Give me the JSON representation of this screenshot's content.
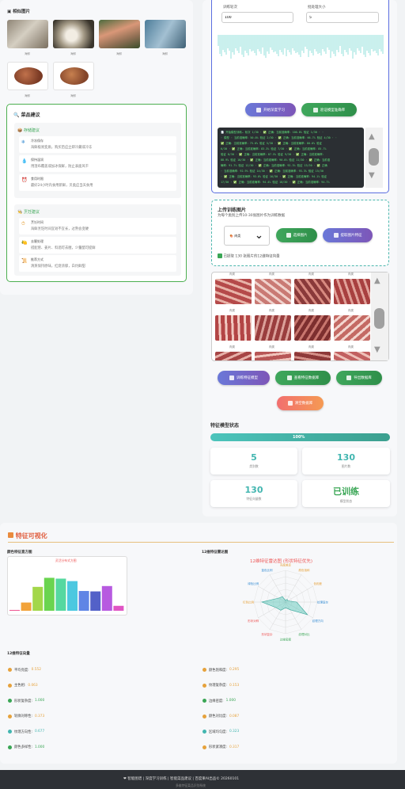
{
  "similar_images": {
    "title": "相似图片",
    "captions": [
      "海鲜",
      "海鲜",
      "海鲜",
      "海鲜",
      "海鲜",
      "海鲜"
    ]
  },
  "advice": {
    "title": "菜品建议",
    "storage": {
      "title": "存储建议",
      "items": [
        {
          "title": "冷冻保存",
          "text": "海鲜极易变质，购买后应立即冷藏或冷冻"
        },
        {
          "title": "保持湿润",
          "text": "用湿布覆盖或加冰保鲜，防止表面风干"
        },
        {
          "title": "食用时限",
          "text": "最好24小时内食用新鲜，贝类应当天食用"
        }
      ]
    },
    "cooking": {
      "title": "烹饪建议",
      "items": [
        {
          "title": "烹饪时间",
          "text": "海鲜烹饪时间宜短不宜长，过熟会变硬"
        },
        {
          "title": "去腥处理",
          "text": "搭配葱、姜片、料酒可去腥，少量醋可提鲜"
        },
        {
          "title": "推荐方式",
          "text": "清蒸保持原味，红烧浓郁，白灼鲜甜"
        }
      ]
    }
  },
  "training": {
    "epochs_label": "训练轮次",
    "epochs_value": "100",
    "batch_label": "批处理大小",
    "batch_value": "5",
    "start_btn": "开始深度学习",
    "verify_btn": "验证模型准确率",
    "log_lines": [
      "📄 开始模型训练… 轮次 1/30 · ✅ 正确：当前准确率：100.0% 验证 1/30 · ·",
      "· 模型 · 当前准确率：50.0% 验证 2/30 · ✅ 正确：当前准确率：66.7% 验证 4/30 · ·",
      "✅ 正确：当前准确率：75.0% 验证 5/30 · ✅ 正确：当前准确率：80.0% 验证",
      "6/30 · ✅ 正确：当前准确率：83.3% 验证 7/30 · ✅ 正确：当前准确率：85.7%",
      "验证 8/30 · ✅ 正确：当前准确率：87.5% 验证 9/30 · ✅ 正确：当前准确率：",
      "88.9% 验证 10/30 · ✅ 正确：当前准确率：90.0% 验证 11/30 · ✅ 正确：当前准",
      "确率：91.7% 验证 12/30 · ✅ 正确：当前准确率：92.3% 验证 13/30 · ✅ 正确",
      "· 当前准确率：92.9% 验证 14/30 · ✅ 正确：当前准确率：93.3% 验证 15/30",
      "· ✅ 正确：当前准确率：93.8% 验证 16/30 · ✅ 正确：当前准确率：94.1% 验证",
      "17/30 · ✅ 正确：当前准确率：94.4% 验证 18/30 · ✅ 正确：当前准确率：94.7%"
    ]
  },
  "upload": {
    "title": "上传训练图片",
    "subtitle": "为每个类别上传10-30张图片作为训练数据",
    "select_value": "🍖 肉类",
    "select_btn": "选择图片",
    "extract_btn": "提取图片特征",
    "status": "已提取 130 张图片的12维特征向量"
  },
  "gallery": {
    "captions": [
      "肉类",
      "肉类",
      "肉类",
      "肉类",
      "肉类",
      "肉类",
      "肉类",
      "肉类",
      "肉类",
      "肉类",
      "肉类",
      "肉类"
    ]
  },
  "actions": {
    "train_btn": "训练特征模型",
    "view_btn": "查看特征数据库",
    "export_btn": "导出数据库",
    "clear_btn": "清空数据库"
  },
  "model_status": {
    "title": "特征模型状态",
    "progress": 100,
    "progress_label": "100%",
    "stats": [
      {
        "value": "5",
        "label": "类别数",
        "color": "#43b6b0"
      },
      {
        "value": "130",
        "label": "图片数",
        "color": "#43b6b0"
      },
      {
        "value": "130",
        "label": "特征向量数",
        "color": "#43b6b0"
      },
      {
        "value": "已训练",
        "label": "模型状态",
        "color": "#3aa655"
      }
    ]
  },
  "visualization": {
    "title": "特征可视化",
    "hist_title": "颜色特征直方图",
    "hist_caption": "灵活分布式方图",
    "radar_title": "12维特征雷达图",
    "radar_caption": "12维特征雷达图 (形状特征优先)",
    "vector_title": "12维特征向量"
  },
  "chart_data": [
    {
      "type": "bar",
      "title": "灵活分布式方图",
      "categories": [
        "1",
        "2",
        "3",
        "4",
        "5",
        "6",
        "7",
        "8",
        "9"
      ],
      "values": [
        0.02,
        0.2,
        0.58,
        0.8,
        0.78,
        0.72,
        0.48,
        0.47,
        0.6,
        0.12
      ],
      "colors": [
        "#ee5a94",
        "#f2a33a",
        "#a3d74a",
        "#6ad44f",
        "#55d8a0",
        "#4cc8e0",
        "#5f85e5",
        "#5361c8",
        "#b75ae0",
        "#e055c4"
      ],
      "ylim": [
        0,
        1
      ]
    },
    {
      "type": "radar",
      "title": "12维特征雷达图 (形状特征优先)",
      "axes": [
        "亮度差异",
        "颜色饱和",
        "色相差",
        "纹理复杂",
        "纹理方向",
        "纹理对比",
        "边缘密度",
        "形状复杂",
        "形状对称",
        "红色比例",
        "绿色比例",
        "蓝色比例"
      ],
      "values": [
        0.05,
        0.1,
        0.08,
        0.35,
        0.8,
        0.28,
        0.18,
        0.3,
        0.35,
        0.75,
        0.25,
        0.2
      ],
      "rlim": [
        0,
        1
      ]
    }
  ],
  "feature_vector": {
    "left": [
      {
        "label": "平均亮度",
        "value": "0.552",
        "color": "#e6a23c"
      },
      {
        "label": "主色相",
        "value": "0.063",
        "color": "#e6a23c"
      },
      {
        "label": "形状复杂度",
        "value": "1.000",
        "color": "#3aa655"
      },
      {
        "label": "轮廓对称性",
        "value": "0.373",
        "color": "#e6a23c"
      },
      {
        "label": "纹理方向性",
        "value": "0.677",
        "color": "#43b6b0"
      },
      {
        "label": "颜色多样性",
        "value": "1.000",
        "color": "#3aa655"
      }
    ],
    "right": [
      {
        "label": "颜色饱和度",
        "value": "0.295",
        "color": "#e6a23c"
      },
      {
        "label": "纹理复杂度",
        "value": "0.153",
        "color": "#e6a23c"
      },
      {
        "label": "边缘密度",
        "value": "1.000",
        "color": "#3aa655"
      },
      {
        "label": "颜色对比度",
        "value": "0.087",
        "color": "#e6a23c"
      },
      {
        "label": "区域均匀度",
        "value": "0.323",
        "color": "#43b6b0"
      },
      {
        "label": "形状紧凑度",
        "value": "0.317",
        "color": "#e6a23c"
      }
    ]
  },
  "footer": {
    "line1": "❤ 智能图谱 | 深度学习训练 | 智能菜品建议 | 百度果AI出品© 20260101",
    "line2": "多维特征菜品识别系统"
  }
}
